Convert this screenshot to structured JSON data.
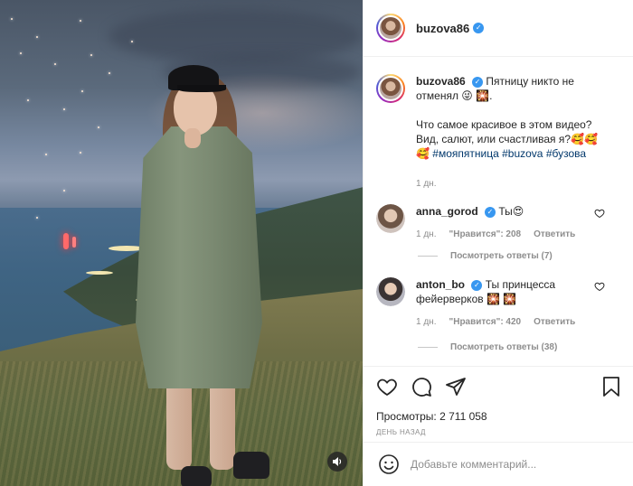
{
  "video": {
    "sound_icon": "speaker-icon"
  },
  "header": {
    "username": "buzova86",
    "verified": true
  },
  "caption": {
    "username": "buzova86",
    "text_line1": "Пятницу никто не",
    "text_line2": "отменял 😜 🎇.",
    "text_line3": "Что самое красивое в этом видео?",
    "text_line4": "Вид, салют, или счастливая я?🥰🥰",
    "emoji_lead": "🥰",
    "tags": [
      "#мояпятница",
      "#buzova",
      "#бузова"
    ],
    "time": "1 дн."
  },
  "comments": [
    {
      "username": "anna_gorod",
      "text": "Ты😍",
      "time": "1 дн.",
      "likes_label": "\"Нравится\": 208",
      "reply_label": "Ответить",
      "view_replies": "Посмотреть ответы (7)"
    },
    {
      "username": "anton_bo",
      "text_line1": "Ты принцесса",
      "text_line2": "фейерверков 🎇 🎇",
      "time": "1 дн.",
      "likes_label": "\"Нравится\": 420",
      "reply_label": "Ответить",
      "view_replies": "Посмотреть ответы (38)"
    }
  ],
  "actions": {
    "views_label": "Просмотры:",
    "views_count": "2 711 058",
    "posted": "ДЕНЬ НАЗАД"
  },
  "add_comment": {
    "placeholder": "Добавьте комментарий..."
  },
  "colors": {
    "link": "#00376b",
    "verified": "#3897f0",
    "muted": "#8e8e8e"
  }
}
